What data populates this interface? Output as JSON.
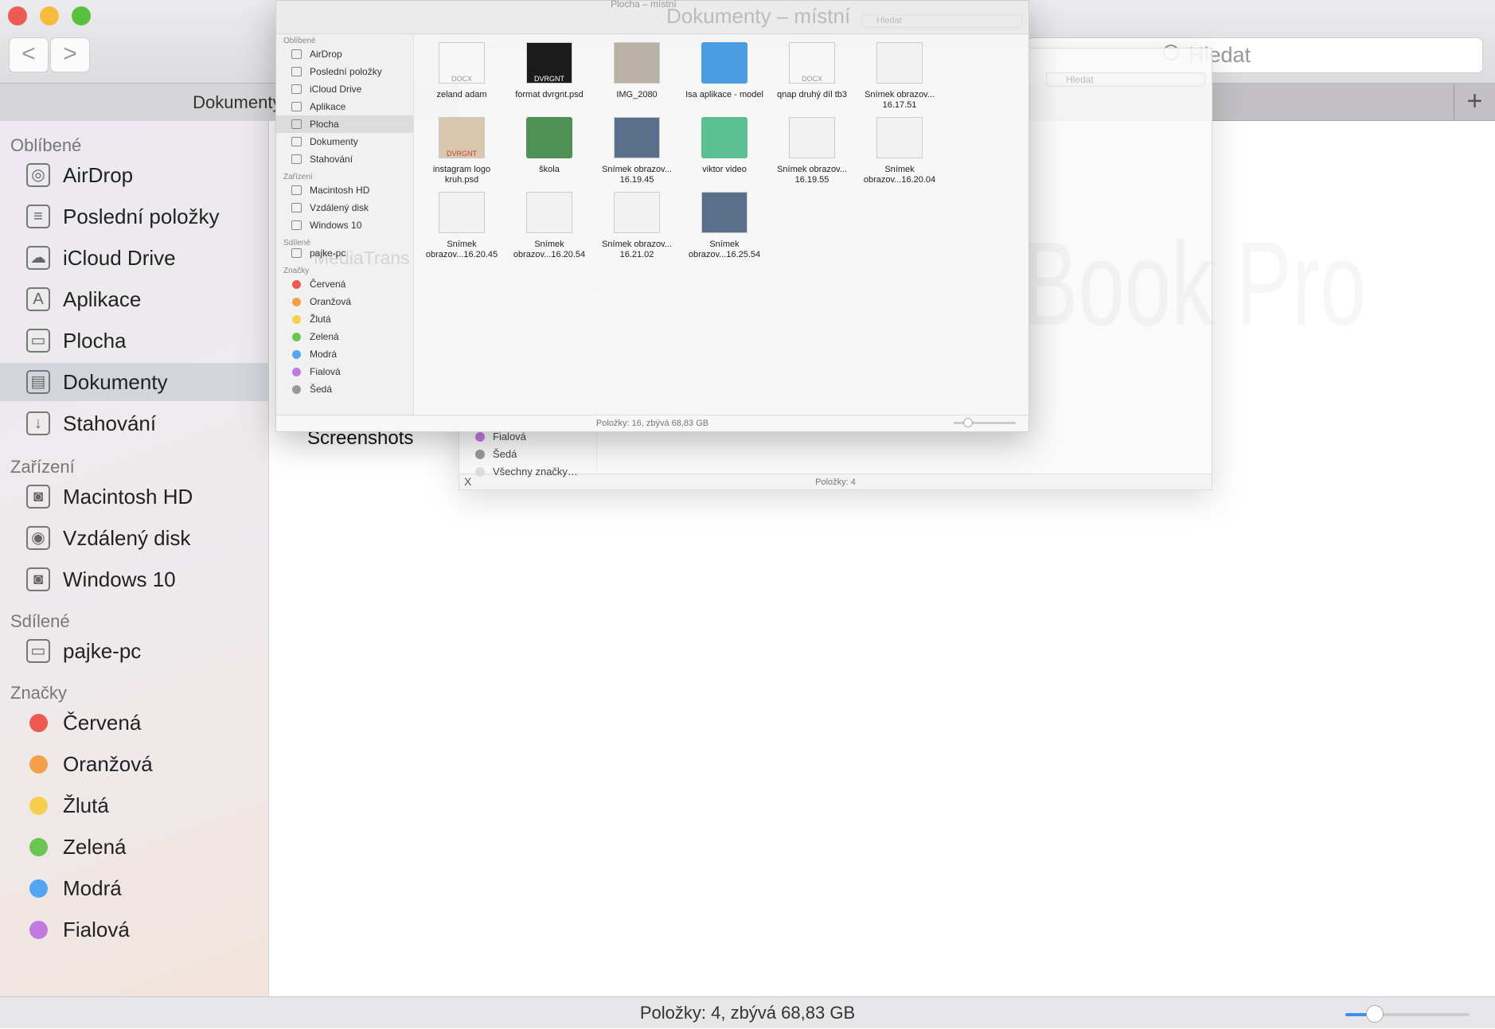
{
  "main_window": {
    "tab_title": "Dokumenty – místní",
    "search_placeholder": "Hledat",
    "back_label": "<",
    "forward_label": ">",
    "new_tab_label": "+",
    "sidebar": {
      "favorites_header": "Oblíbené",
      "favorites": [
        {
          "label": "AirDrop",
          "icon": "airdrop-icon",
          "glyph": "◎"
        },
        {
          "label": "Poslední položky",
          "icon": "recents-icon",
          "glyph": "≡"
        },
        {
          "label": "iCloud Drive",
          "icon": "cloud-icon",
          "glyph": "☁"
        },
        {
          "label": "Aplikace",
          "icon": "applications-icon",
          "glyph": "A"
        },
        {
          "label": "Plocha",
          "icon": "desktop-icon",
          "glyph": "▭"
        },
        {
          "label": "Dokumenty",
          "icon": "documents-icon",
          "glyph": "▤",
          "selected": true
        },
        {
          "label": "Stahování",
          "icon": "downloads-icon",
          "glyph": "↓"
        }
      ],
      "devices_header": "Zařízení",
      "devices": [
        {
          "label": "Macintosh HD",
          "icon": "hard-drive-icon",
          "glyph": "◙"
        },
        {
          "label": "Vzdálený disk",
          "icon": "remote-disc-icon",
          "glyph": "◉"
        },
        {
          "label": "Windows 10",
          "icon": "hard-drive-icon",
          "glyph": "◙"
        }
      ],
      "shared_header": "Sdílené",
      "shared": [
        {
          "label": "pajke-pc",
          "icon": "pc-icon",
          "glyph": "▭"
        }
      ],
      "tags_header": "Značky",
      "tags": [
        {
          "label": "Červená",
          "color": "#ee5a4f"
        },
        {
          "label": "Oranžová",
          "color": "#f3a04a"
        },
        {
          "label": "Žlutá",
          "color": "#f6cf4e"
        },
        {
          "label": "Zelená",
          "color": "#6bc551"
        },
        {
          "label": "Modrá",
          "color": "#51a6ef"
        },
        {
          "label": "Fialová",
          "color": "#c27ae0"
        }
      ]
    },
    "content_item": "Screenshots",
    "status": "Položky: 4, zbývá 68,83 GB",
    "icon_size_slider": 0.2
  },
  "background_window": {
    "search_placeholder": "Hledat",
    "status": "Položky: 4",
    "close_label": "X",
    "watermark": "Pavel - MacBook Pro",
    "tags": [
      {
        "label": "Fialová",
        "color": "#c27ae0"
      },
      {
        "label": "Šedá",
        "color": "#999999"
      },
      {
        "label": "Všechny značky…",
        "color": "#dddddd"
      }
    ]
  },
  "front_window": {
    "title": "Plocha – místní",
    "ghost_title": "Dokumenty – místní",
    "search_placeholder": "Hledat",
    "overlay_text": "MediaTrans",
    "sidebar": {
      "favorites_header": "Oblíbené",
      "favorites": [
        "AirDrop",
        "Poslední položky",
        "iCloud Drive",
        "Aplikace",
        "Plocha",
        "Dokumenty",
        "Stahování"
      ],
      "selected": "Plocha",
      "devices_header": "Zařízení",
      "devices": [
        "Macintosh HD",
        "Vzdálený disk",
        "Windows 10"
      ],
      "shared_header": "Sdílené",
      "shared": [
        "pajke-pc"
      ],
      "tags_header": "Značky",
      "tags": [
        {
          "label": "Červená",
          "color": "#ee5a4f"
        },
        {
          "label": "Oranžová",
          "color": "#f3a04a"
        },
        {
          "label": "Žlutá",
          "color": "#f6cf4e"
        },
        {
          "label": "Zelená",
          "color": "#6bc551"
        },
        {
          "label": "Modrá",
          "color": "#51a6ef"
        },
        {
          "label": "Fialová",
          "color": "#c27ae0"
        },
        {
          "label": "Šedá",
          "color": "#999999"
        }
      ]
    },
    "files": [
      {
        "name": "zeland adam",
        "kind": "docx",
        "badge": "DOCX"
      },
      {
        "name": "format dvrgnt.psd",
        "kind": "image-dark",
        "badge": "DVRGNT"
      },
      {
        "name": "IMG_2080",
        "kind": "photo",
        "badge": ""
      },
      {
        "name": "Isa aplikace - model",
        "kind": "folder-blue",
        "badge": ""
      },
      {
        "name": "qnap druhý díl tb3",
        "kind": "docx",
        "badge": "DOCX"
      },
      {
        "name": "Snímek obrazov... 16.17.51",
        "kind": "screenshot",
        "badge": ""
      },
      {
        "name": "instagram logo kruh.psd",
        "kind": "image-beige",
        "badge": "DVRGNT"
      },
      {
        "name": "škola",
        "kind": "folder-green",
        "badge": ""
      },
      {
        "name": "Snímek obrazov... 16.19.45",
        "kind": "screenshot-dark",
        "badge": ""
      },
      {
        "name": "viktor video",
        "kind": "folder-teal",
        "badge": ""
      },
      {
        "name": "Snímek obrazov... 16.19.55",
        "kind": "screenshot",
        "badge": ""
      },
      {
        "name": "Snímek obrazov...16.20.04",
        "kind": "screenshot",
        "badge": ""
      },
      {
        "name": "Snímek obrazov...16.20.45",
        "kind": "screenshot",
        "badge": ""
      },
      {
        "name": "Snímek obrazov...16.20.54",
        "kind": "screenshot",
        "badge": ""
      },
      {
        "name": "Snímek obrazov... 16.21.02",
        "kind": "screenshot",
        "badge": ""
      },
      {
        "name": "Snímek obrazov...16.25.54",
        "kind": "screenshot-dark",
        "badge": ""
      }
    ],
    "status": "Položky: 16, zbývá 68,83 GB",
    "icon_size_slider": 0.2
  }
}
